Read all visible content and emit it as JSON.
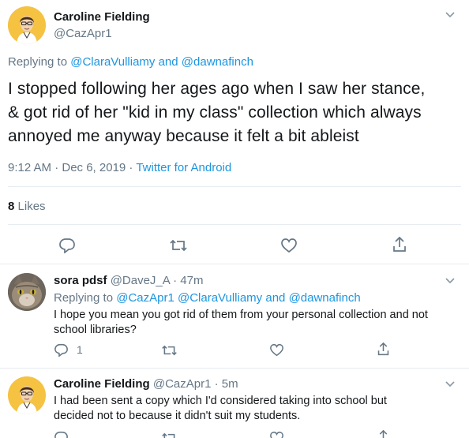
{
  "main_tweet": {
    "author_name": "Caroline Fielding",
    "author_handle": "@CazApr1",
    "replying_prefix": "Replying to",
    "replying_to_1": "@ClaraVulliamy",
    "replying_and": "and",
    "replying_to_2": "@dawnafinch",
    "text_line_1": "I stopped following her ages ago when I saw her stance,",
    "text_line_2": "& got rid of her \"kid in my class\" collection which always",
    "text_line_3": "annoyed me anyway because it felt a bit ableist",
    "timestamp": "9:12 AM · Dec 6, 2019 ·",
    "source": "Twitter for Android",
    "likes_count": "8",
    "likes_label": "Likes"
  },
  "reply_1": {
    "author_name": "sora pdsf",
    "author_handle": "@DaveJ_A",
    "time": "· 47m",
    "replying_prefix": "Replying to",
    "replying_to_1": "@CazApr1",
    "replying_to_2": "@ClaraVulliamy",
    "replying_and": "and",
    "replying_to_3": "@dawnafinch",
    "text_line_1": "I hope you mean you got rid of them from your personal collection and not",
    "text_line_2": "school libraries?",
    "reply_count": "1"
  },
  "reply_2": {
    "author_name": "Caroline Fielding",
    "author_handle": "@CazApr1",
    "time": "· 5m",
    "text_line_1": "I had been sent a copy which I'd considered taking into school but",
    "text_line_2": "decided not to because it didn't suit my students."
  },
  "colors": {
    "link": "#1b95e0",
    "muted": "#657786",
    "divider": "#e6ecf0",
    "avatar_caroline": "#f5c242",
    "avatar_sora": "#8a7d6e"
  },
  "icons": [
    "chevron-down-icon",
    "reply-icon",
    "retweet-icon",
    "like-icon",
    "share-icon"
  ]
}
